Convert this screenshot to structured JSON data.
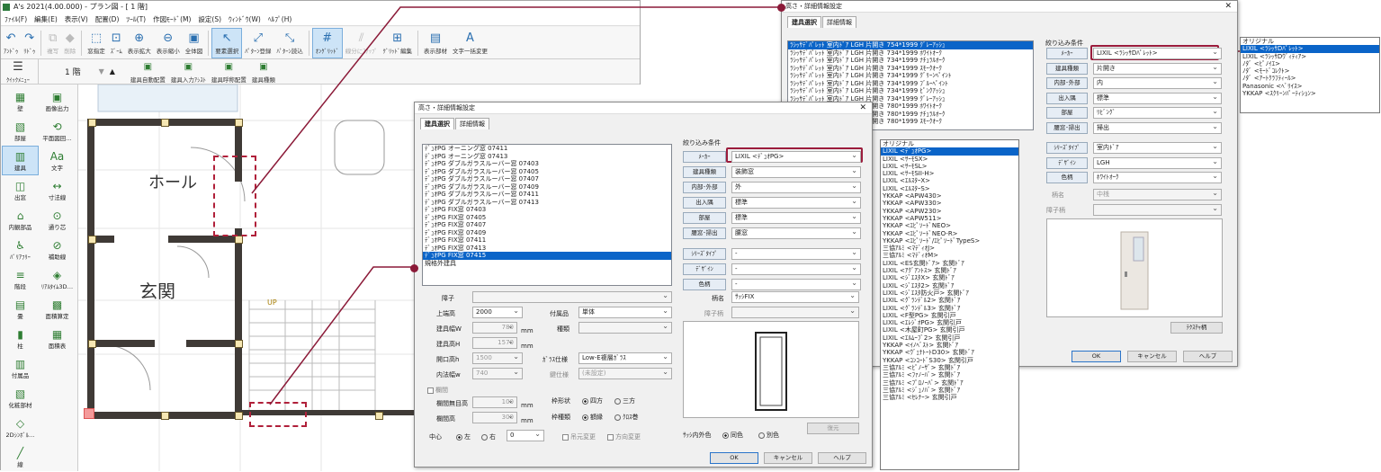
{
  "app": {
    "title": "A's 2021(4.00.000) - プラン図 - [ 1 階]",
    "menu": [
      "ﾌｧｲﾙ(F)",
      "編集(E)",
      "表示(V)",
      "配置(D)",
      "ﾂｰﾙ(T)",
      "作図ﾓｰﾄﾞ(M)",
      "設定(S)",
      "ｳｨﾝﾄﾞｳ(W)",
      "ﾍﾙﾌﾟ(H)"
    ],
    "toolbar": [
      {
        "label": "ｱﾝﾄﾞｩ",
        "icon": "undo-icon",
        "glyph": "↶",
        "dis": false
      },
      {
        "label": "ﾘﾄﾞｩ",
        "icon": "redo-icon",
        "glyph": "↷",
        "dis": false
      },
      {
        "label": "複写",
        "icon": "copy-icon",
        "glyph": "⧉",
        "dis": true
      },
      {
        "label": "削除",
        "icon": "delete-icon",
        "glyph": "◆",
        "dis": true
      },
      {
        "label": "窓指定",
        "icon": "window-select-icon",
        "glyph": "⬚",
        "dis": false
      },
      {
        "label": "ｽﾞｰﾑ",
        "icon": "zoom-icon",
        "glyph": "⊡",
        "dis": false
      },
      {
        "label": "表示拡大",
        "icon": "zoom-in-icon",
        "glyph": "⊕",
        "dis": false
      },
      {
        "label": "表示縮小",
        "icon": "zoom-out-icon",
        "glyph": "⊖",
        "dis": false
      },
      {
        "label": "全体図",
        "icon": "full-view-icon",
        "glyph": "▣",
        "dis": false
      },
      {
        "label": "要素選択",
        "icon": "cursor-icon",
        "glyph": "↖",
        "dis": false,
        "act": true
      },
      {
        "label": "ﾊﾟﾀｰﾝ登録",
        "icon": "pattern-register-icon",
        "glyph": "⤢",
        "dis": false
      },
      {
        "label": "ﾊﾟﾀｰﾝ読込",
        "icon": "pattern-load-icon",
        "glyph": "⤡",
        "dis": false
      },
      {
        "label": "ｵﾝｸﾞﾘｯﾄﾞ",
        "icon": "grid-icon",
        "glyph": "#",
        "dis": false,
        "act": true
      },
      {
        "label": "線分にｽﾅｯﾌﾟ",
        "icon": "snap-icon",
        "glyph": "⫽",
        "dis": true
      },
      {
        "label": "ｸﾞﾘｯﾄﾞ編集",
        "icon": "grid-edit-icon",
        "glyph": "⊞",
        "dis": false
      },
      {
        "label": "表示部材",
        "icon": "display-parts-icon",
        "glyph": "▤",
        "dis": false
      },
      {
        "label": "文字一括変更",
        "icon": "text-change-icon",
        "glyph": "A",
        "dis": false
      }
    ],
    "quick_menu": "ｸｲｯｸﾒﾆｭｰ",
    "floor": "1 階",
    "toolbar2": [
      "建具自動配置",
      "建具入力ｱｼｽﾄ",
      "建具呼称配置",
      "建具種類"
    ],
    "left_tools": [
      [
        "壁",
        "wall-icon",
        "▦"
      ],
      [
        "画像出力",
        "image-export-icon",
        "▣"
      ],
      [
        "部屋",
        "room-icon",
        "▧"
      ],
      [
        "平面図回…",
        "plan-rotate-icon",
        "⟲"
      ],
      [
        "建具",
        "fixture-icon",
        "▥"
      ],
      [
        "文字",
        "text-icon",
        "Aa"
      ],
      [
        "出窓",
        "bay-window-icon",
        "◫"
      ],
      [
        "寸法線",
        "dimension-icon",
        "↔"
      ],
      [
        "内観部品",
        "interior-parts-icon",
        "⌂"
      ],
      [
        "通り芯",
        "grid-line-icon",
        "⊙"
      ],
      [
        "ﾊﾞﾘｱﾌﾘｰ",
        "barrier-free-icon",
        "♿"
      ],
      [
        "補助線",
        "guide-line-icon",
        "⊘"
      ],
      [
        "階段",
        "stairs-icon",
        "≡"
      ],
      [
        "ﾘｱﾙﾀｲﾑ3D…",
        "realtime-3d-icon",
        "◈"
      ],
      [
        "畳",
        "tatami-icon",
        "▤"
      ],
      [
        "面積算定",
        "area-calc-icon",
        "▩"
      ],
      [
        "柱",
        "column-icon",
        "▮"
      ],
      [
        "面積表",
        "area-table-icon",
        "▦"
      ],
      [
        "付属品",
        "accessory-icon",
        "▥"
      ],
      [
        "",
        "",
        " "
      ],
      [
        "化粧部材",
        "finish-parts-icon",
        "▧"
      ],
      [
        "",
        "",
        " "
      ],
      [
        "2Dｼﾝﾎﾞﾙ…",
        "symbol-2d-icon",
        "◇"
      ],
      [
        "",
        "",
        " "
      ],
      [
        "線",
        "line-icon",
        "╱"
      ]
    ],
    "plan": {
      "hall": "ホール",
      "genkan": "玄関",
      "up": "UP"
    }
  },
  "dlg1": {
    "title": "高さ・詳細情報設定",
    "tabs": [
      "建具選択",
      "詳細情報"
    ],
    "list": [
      "ﾃﾞｭｵPG オーニング窓 07411",
      "ﾃﾞｭｵPG オーニング窓 07413",
      "ﾃﾞｭｵPG ダブルガラスルーバー窓 07403",
      "ﾃﾞｭｵPG ダブルガラスルーバー窓 07405",
      "ﾃﾞｭｵPG ダブルガラスルーバー窓 07407",
      "ﾃﾞｭｵPG ダブルガラスルーバー窓 07409",
      "ﾃﾞｭｵPG ダブルガラスルーバー窓 07411",
      "ﾃﾞｭｵPG ダブルガラスルーバー窓 07413",
      "ﾃﾞｭｵPG FIX窓 07403",
      "ﾃﾞｭｵPG FIX窓 07405",
      "ﾃﾞｭｵPG FIX窓 07407",
      "ﾃﾞｭｵPG FIX窓 07409",
      "ﾃﾞｭｵPG FIX窓 07411",
      "ﾃﾞｭｵPG FIX窓 07413",
      "ﾃﾞｭｵPG FIX窓 07415",
      "規格外建具"
    ],
    "filter_title": "絞り込み条件",
    "filters": [
      [
        "ﾒｰｶｰ",
        "LIXIL <ﾃﾞｭｵPG>"
      ],
      [
        "建具種類",
        "装飾窓"
      ],
      [
        "内部･外部",
        "外"
      ],
      [
        "出入隅",
        "標準"
      ],
      [
        "部屋",
        "標準"
      ],
      [
        "腰窓･掃出",
        "腰窓"
      ],
      [
        "ｼﾘｰｽﾞﾀｲﾌﾟ",
        "-"
      ],
      [
        "ﾃﾞｻﾞｲﾝ",
        "-"
      ],
      [
        "色柄",
        "-"
      ]
    ],
    "shoji": "障子",
    "kamachi": "上端高",
    "kamachi_val": "2000",
    "fuzoku": "付属品",
    "fuzoku_val": "単体",
    "width": "建具幅W",
    "width_val": "780",
    "height": "建具高H",
    "height_val": "1570",
    "shurui": "種類",
    "kaikou": "開口高h",
    "kaikou_val": "1500",
    "uchinori": "内法幅w",
    "uchinori_val": "740",
    "glass": "ｶﾞﾗｽ仕様",
    "glass_val": "Low-E複層ｶﾞﾗｽ",
    "lock": "鍵仕様",
    "lock_val": "(未設定)",
    "mm": "mm",
    "ranma": "欄間",
    "ranma_noh": "欄間無目高",
    "ranma_noh_val": "100",
    "ranma_h": "欄間高",
    "ranma_h_val": "300",
    "waku": "枠形状",
    "waku_a": "四方",
    "waku_b": "三方",
    "wakus": "枠種類",
    "wakus_a": "額縁",
    "wakus_b": "ｸﾛｽ巻",
    "center": "中心",
    "left": "左",
    "right": "右",
    "center_val": "0",
    "mado1": "吊元変更",
    "mado2": "方向変更",
    "gara": "柄名",
    "gara_val": "ｻｯｼFIX",
    "shoji_gara": "障子柄",
    "sash_color": "ｻｯｼ内外色",
    "same": "同色",
    "diff": "別色",
    "restore": "復元",
    "ok": "OK",
    "cancel": "キャンセル",
    "help": "ヘルプ"
  },
  "popup1": [
    "オリジナル",
    "LIXIL <ﾃﾞｭｵPG>",
    "LIXIL <ｻｰﾓSX>",
    "LIXIL <ｻｰﾓSL>",
    "LIXIL <ｻｰﾓSII-H>",
    "LIXIL <ｴﾙｽﾀｰX>",
    "LIXIL <ｴﾙｽﾀｰS>",
    "YKKAP <APW430>",
    "YKKAP <APW330>",
    "YKKAP <APW230>",
    "YKKAP <APW511>",
    "YKKAP <ｴﾋﾟｿｰﾄﾞNEO>",
    "YKKAP <ｴﾋﾟｿｰﾄﾞNEO-R>",
    "YKKAP <ｴﾋﾟｿｰﾄﾞ/ｴﾋﾟｿｰﾄﾞTypeS>",
    "三協ｱﾙﾐ <ﾏﾃﾞｨｵJ>",
    "三協ｱﾙﾐ <ﾏﾃﾞｨｵM>",
    "LIXIL <ES玄関ﾄﾞｱ> 玄関ﾄﾞｱ",
    "LIXIL <ｱｸﾞｱﾝﾄｽ> 玄関ﾄﾞｱ",
    "LIXIL <ｼﾞｴｽﾀX> 玄関ﾄﾞｱ",
    "LIXIL <ｼﾞｴｽﾀ2> 玄関ﾄﾞｱ",
    "LIXIL <ｼﾞｴｽﾀ防火戸> 玄関ﾄﾞｱ",
    "LIXIL <ｸﾞﾗﾝﾃﾞﾙ2> 玄関ﾄﾞｱ",
    "LIXIL <ｸﾞﾗﾝﾃﾞﾙ3> 玄関ﾄﾞｱ",
    "LIXIL <F型PG> 玄関引戸",
    "LIXIL <ｴﾚｼﾞｵPG> 玄関引戸",
    "LIXIL <木屋町PG> 玄関引戸",
    "LIXIL <ｴﾙﾑｰﾌﾞ2> 玄関引戸",
    "YKKAP <ｲﾉﾍﾞｽﾄ> 玄関ﾄﾞｱ",
    "YKKAP <ｳﾞｪﾅﾄｰﾄD30> 玄関ﾄﾞｱ",
    "YKKAP <ｺﾝｺｰﾄﾞS30> 玄関引戸",
    "三協ｱﾙﾐ <ﾋﾟﾉｰｻﾞ> 玄関ﾄﾞｱ",
    "三協ｱﾙﾐ <ﾌｧﾉｰﾊﾞ> 玄関ﾄﾞｱ",
    "三協ｱﾙﾐ <ﾌﾟﾛﾉｰﾊﾞ> 玄関ﾄﾞｱ",
    "三協ｱﾙﾐ <ｼﾞｭﾉﾊﾞ> 玄関ﾄﾞｱ",
    "三協ｱﾙﾐ <ｾﾚﾅｰ> 玄関引戸"
  ],
  "dlg2": {
    "title": "高さ・詳細情報設定",
    "tabs": [
      "建具選択",
      "詳細情報"
    ],
    "list": [
      "ﾗｼｯｻﾃﾞﾊﾟﾚｯﾄ 室内ﾄﾞｱ LGH 片開き 754*1999 ｸﾞﾚｰｱｯｼｭ",
      "ﾗｼｯｻﾃﾞﾊﾟﾚｯﾄ 室内ﾄﾞｱ LGH 片開き 734*1999 ﾎﾜｲﾄｵｰｸ",
      "ﾗｼｯｻﾃﾞﾊﾟﾚｯﾄ 室内ﾄﾞｱ LGH 片開き 734*1999 ﾅﾁｭﾗﾙｵｰｸ",
      "ﾗｼｯｻﾃﾞﾊﾟﾚｯﾄ 室内ﾄﾞｱ LGH 片開き 734*1999 ｽﾓｰｸｵｰｸ",
      "ﾗｼｯｻﾃﾞﾊﾟﾚｯﾄ 室内ﾄﾞｱ LGH 片開き 734*1999 ｸﾞﾘｰﾝﾍﾟｲﾝﾄ",
      "ﾗｼｯｻﾃﾞﾊﾟﾚｯﾄ 室内ﾄﾞｱ LGH 片開き 734*1999 ﾌﾞﾙｰﾍﾟｲﾝﾄ",
      "ﾗｼｯｻﾃﾞﾊﾟﾚｯﾄ 室内ﾄﾞｱ LGH 片開き 734*1999 ﾋﾟﾝｸｱｯｼｭ",
      "ﾗｼｯｻﾃﾞﾊﾟﾚｯﾄ 室内ﾄﾞｱ LGH 片開き 734*1999 ｸﾞﾚｰｱｯｼｭ",
      "ﾗｼｯｻﾃﾞﾊﾟﾚｯﾄ 室内ﾄﾞｱ LGH 片開き 780*1999 ﾎﾜｲﾄｵｰｸ",
      "ﾗｼｯｻﾃﾞﾊﾟﾚｯﾄ 室内ﾄﾞｱ LGH 片開き 780*1999 ﾅﾁｭﾗﾙｵｰｸ",
      "ﾗｼｯｻﾃﾞﾊﾟﾚｯﾄ 室内ﾄﾞｱ LGH 片開き 780*1999 ｽﾓｰｸｵｰｸ"
    ],
    "filter_title": "絞り込み条件",
    "filters": [
      [
        "ﾒｰｶｰ",
        "LIXIL <ﾗｼｯｻDﾊﾟﾚｯﾄ>"
      ],
      [
        "建具種類",
        "片開き"
      ],
      [
        "内部･外部",
        "内"
      ],
      [
        "出入隅",
        "標準"
      ],
      [
        "部屋",
        "ﾘﾋﾞﾝｸﾞ"
      ],
      [
        "腰窓･掃出",
        "掃出"
      ],
      [
        "ｼﾘｰｽﾞﾀｲﾌﾟ",
        "室内ﾄﾞｱ"
      ],
      [
        "ﾃﾞｻﾞｲﾝ",
        "LGH"
      ],
      [
        "色柄",
        "ﾎﾜｲﾄｵｰｸ"
      ]
    ],
    "gara": "柄名",
    "gara_val": "中桟",
    "shoji_gara": "障子柄",
    "texture": "ﾃｸｽﾁｬ柄",
    "ok": "OK",
    "cancel": "キャンセル",
    "help": "ヘルプ"
  },
  "popup2": [
    "オリジナル",
    "LIXIL <ﾗｼｯｻDﾊﾟﾚｯﾄ>",
    "LIXIL <ﾗｼｯｻDｳﾞｨﾃｨｱ>",
    "ﾉﾀﾞ <ﾋﾟﾉｲｴ>",
    "ﾉﾀﾞ <ﾓｰﾄﾞｺﾚｸﾄ>",
    "ﾉﾀﾞ <ｱｰﾄｸﾗﾌﾃｨｰﾙ>",
    "Panasonic <ﾍﾞﾘｲｽ>",
    "YKKAP <ｽｸﾘｰﾝﾊﾟｰﾃｨｼｮﾝ>"
  ]
}
